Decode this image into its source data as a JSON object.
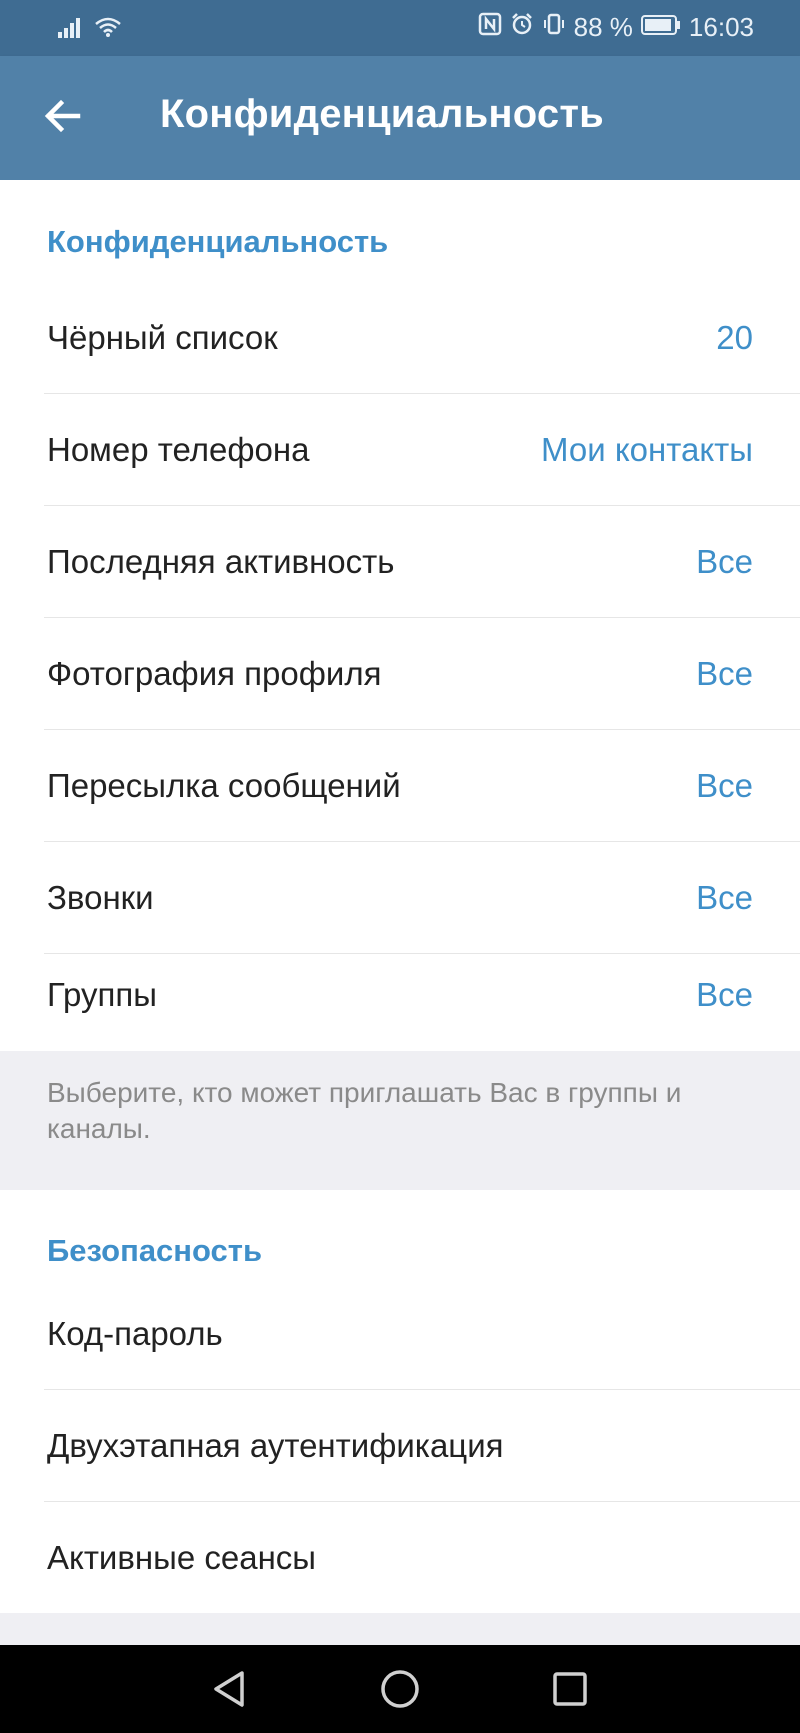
{
  "status_bar": {
    "battery_percent": "88 %",
    "time": "16:03",
    "icons": [
      "signal-icon",
      "wifi-icon",
      "nfc-icon",
      "alarm-icon",
      "vibrate-icon",
      "battery-icon"
    ]
  },
  "app_bar": {
    "title": "Конфиденциальность",
    "back_icon": "arrow-left-icon"
  },
  "privacy": {
    "header": "Конфиденциальность",
    "items": [
      {
        "label": "Чёрный список",
        "value": "20"
      },
      {
        "label": "Номер телефона",
        "value": "Мои контакты"
      },
      {
        "label": "Последняя активность",
        "value": "Все"
      },
      {
        "label": "Фотография профиля",
        "value": "Все"
      },
      {
        "label": "Пересылка сообщений",
        "value": "Все"
      },
      {
        "label": "Звонки",
        "value": "Все"
      },
      {
        "label": "Группы",
        "value": "Все"
      }
    ],
    "hint": "Выберите, кто может приглашать Вас в группы и каналы."
  },
  "security": {
    "header": "Безопасность",
    "items": [
      {
        "label": "Код-пароль"
      },
      {
        "label": "Двухэтапная аутентификация"
      },
      {
        "label": "Активные сеансы"
      }
    ]
  },
  "nav_bar": {
    "buttons": [
      "back-triangle-icon",
      "home-circle-icon",
      "recents-square-icon"
    ]
  },
  "colors": {
    "status_bar": "#3f6c92",
    "app_bar": "#5181a8",
    "accent": "#3f8fc9",
    "background": "#efeff3"
  }
}
